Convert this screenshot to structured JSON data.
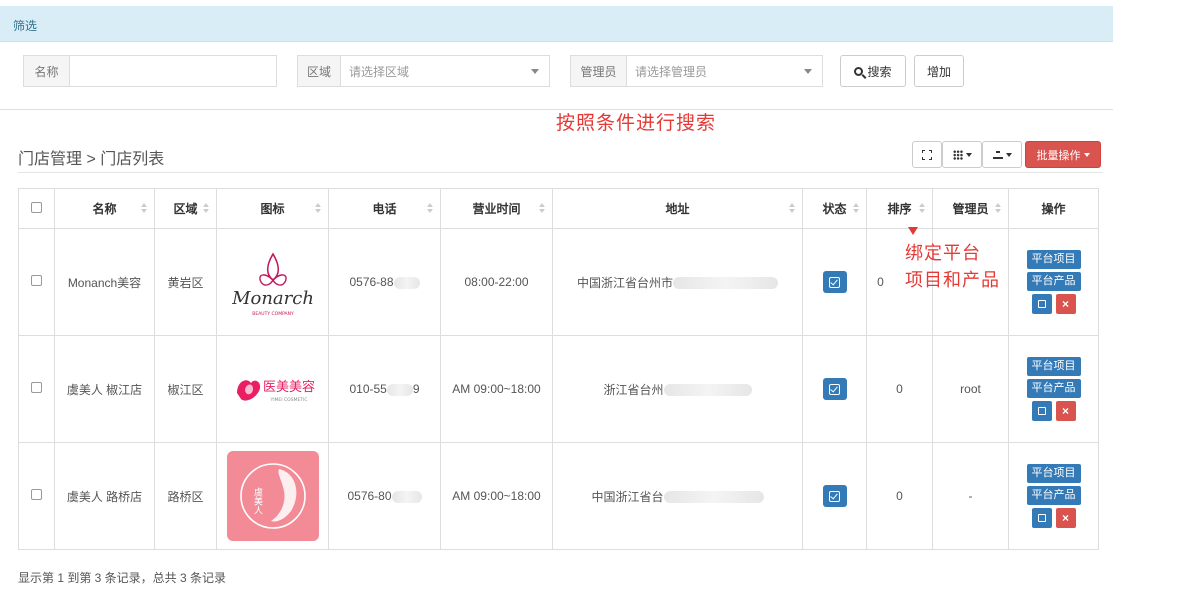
{
  "filter": {
    "title": "筛选"
  },
  "search": {
    "name_label": "名称",
    "name_value": "",
    "region_label": "区域",
    "region_placeholder": "请选择区域",
    "manager_label": "管理员",
    "manager_placeholder": "请选择管理员",
    "search_button": "搜索",
    "add_button": "增加"
  },
  "annotations": {
    "search_note": "按照条件进行搜索",
    "bind_note_line1": "绑定平台",
    "bind_note_line2": "项目和产品"
  },
  "breadcrumb": "门店管理 > 门店列表",
  "toolbar": {
    "batch_label": "批量操作"
  },
  "table": {
    "headers": {
      "name": "名称",
      "region": "区域",
      "logo": "图标",
      "phone": "电话",
      "hours": "营业时间",
      "address": "地址",
      "status": "状态",
      "sort": "排序",
      "manager": "管理员",
      "actions": "操作"
    },
    "rows": [
      {
        "name": "Monanch美容",
        "region": "黄岩区",
        "logo_text": "Monarch",
        "logo_sub": "BEAUTY COMPANY",
        "phone": "0576-88",
        "hours": "08:00-22:00",
        "address": "中国浙江省台州市",
        "sort": "0",
        "manager": ""
      },
      {
        "name": "虞美人 椒江店",
        "region": "椒江区",
        "logo_text": "医美美容",
        "logo_sub": "YIMEI COSMETIC",
        "phone": "010-55",
        "phone_tail": "9",
        "hours": "AM 09:00~18:00",
        "address": "浙江省台州",
        "sort": "0",
        "manager": "root"
      },
      {
        "name": "虞美人 路桥店",
        "region": "路桥区",
        "logo_text": "虞美人",
        "logo_sub": "",
        "phone": "0576-80",
        "hours": "AM 09:00~18:00",
        "address": "中国浙江省台",
        "sort": "0",
        "manager": "-"
      }
    ],
    "op_project": "平台项目",
    "op_product": "平台产品",
    "op_delete": "×"
  },
  "footer": "显示第 1 到第 3 条记录，总共 3 条记录",
  "colors": {
    "primary": "#337ab7",
    "danger": "#d9534f",
    "annotation": "#e53935",
    "filter_bg": "#d9edf7"
  }
}
